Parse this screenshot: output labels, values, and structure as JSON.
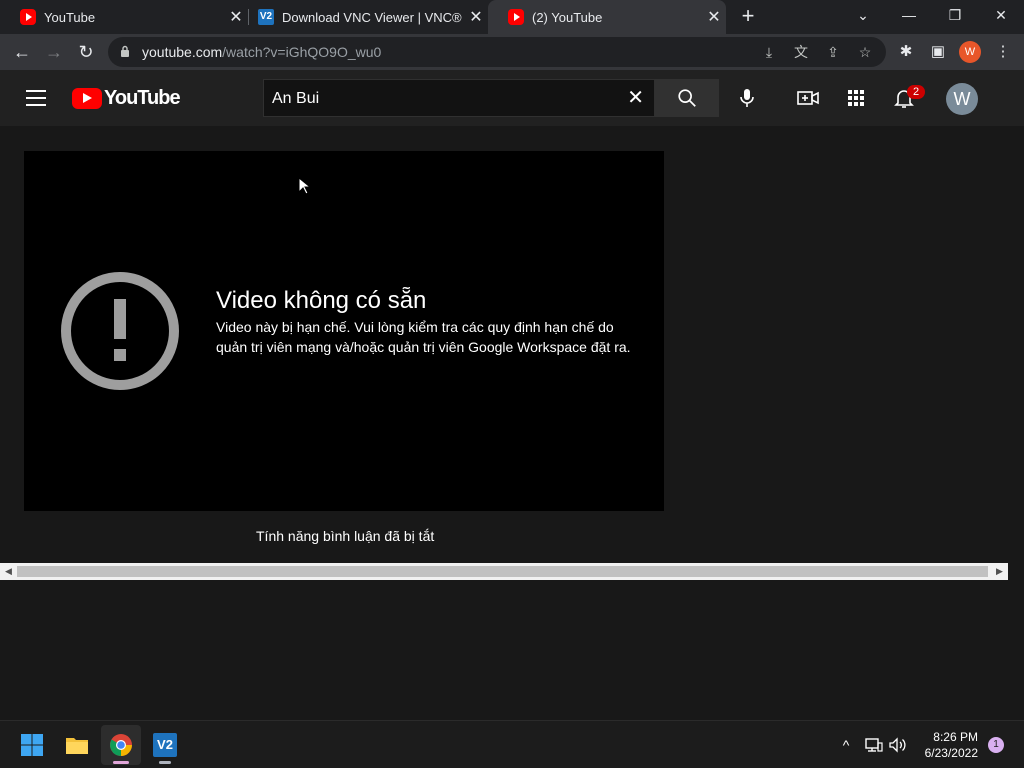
{
  "browser": {
    "tabs": [
      {
        "title": "YouTube",
        "favicon": "youtube-icon",
        "active": false
      },
      {
        "title": "Download VNC Viewer | VNC® C",
        "favicon": "vnc-icon",
        "active": false
      },
      {
        "title": "(2) YouTube",
        "favicon": "youtube-icon",
        "active": true
      }
    ],
    "url_domain": "youtube.com",
    "url_path": "/watch?v=iGhQO9O_wu0",
    "profile_initial": "W"
  },
  "youtube": {
    "logo_text": "YouTube",
    "search_value": "An Bui",
    "notification_count": "2",
    "avatar_initial": "W",
    "error_title": "Video không có sẵn",
    "error_message": "Video này bị hạn chế. Vui lòng kiểm tra các quy định hạn chế do quản trị viên mạng và/hoặc quản trị viên Google Workspace đặt ra.",
    "comments_status": "Tính năng bình luận đã bị tắt"
  },
  "taskbar": {
    "apps": [
      "windows-start-icon",
      "file-explorer-icon",
      "chrome-icon",
      "vnc-viewer-icon"
    ],
    "time": "8:26 PM",
    "date": "6/23/2022",
    "notification_count": "1"
  },
  "colors": {
    "youtube_red": "#ff0000",
    "page_bg": "#181818",
    "header_bg": "#212121"
  }
}
